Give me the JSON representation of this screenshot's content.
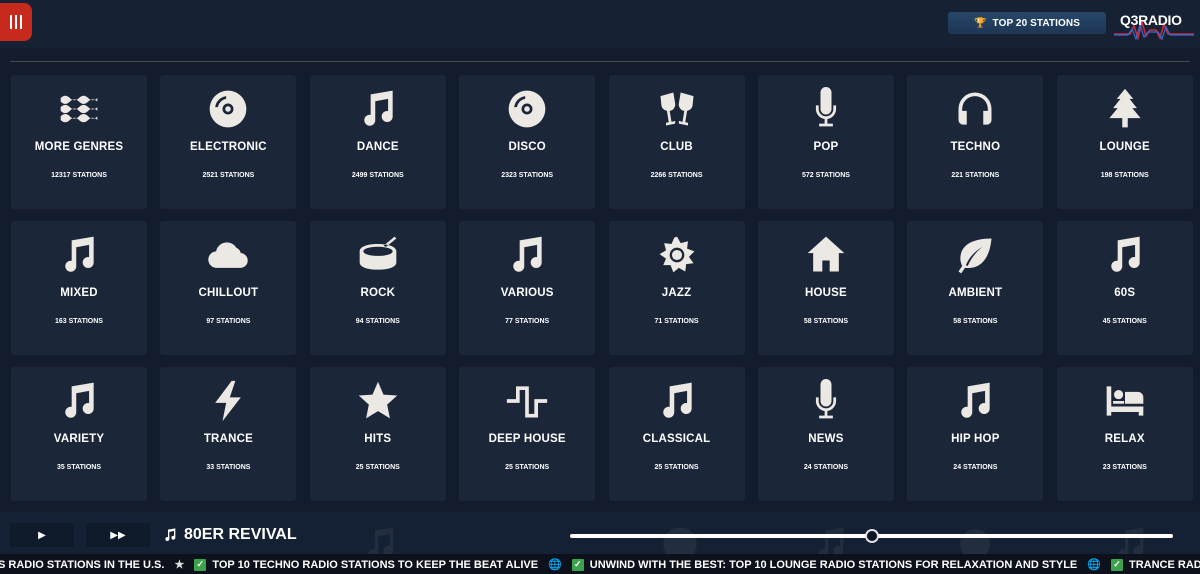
{
  "header": {
    "menu_icon": "hamburger-icon",
    "top20_label": "TOP 20 STATIONS",
    "trophy_icon": "trophy-icon",
    "logo_text": "Q3RADIO",
    "accent": "#c8291d"
  },
  "genres": [
    {
      "name": "MORE GENRES",
      "count": "12317 STATIONS",
      "icon": "waves-icon"
    },
    {
      "name": "ELECTRONIC",
      "count": "2521 STATIONS",
      "icon": "record-icon"
    },
    {
      "name": "DANCE",
      "count": "2499 STATIONS",
      "icon": "music-note-icon"
    },
    {
      "name": "DISCO",
      "count": "2323 STATIONS",
      "icon": "record-icon"
    },
    {
      "name": "CLUB",
      "count": "2266 STATIONS",
      "icon": "glasses-cheers-icon"
    },
    {
      "name": "POP",
      "count": "572 STATIONS",
      "icon": "microphone-icon"
    },
    {
      "name": "TECHNO",
      "count": "221 STATIONS",
      "icon": "headphones-icon"
    },
    {
      "name": "LOUNGE",
      "count": "198 STATIONS",
      "icon": "tree-icon"
    },
    {
      "name": "MIXED",
      "count": "163 STATIONS",
      "icon": "music-note-icon"
    },
    {
      "name": "CHILLOUT",
      "count": "97 STATIONS",
      "icon": "cloud-icon"
    },
    {
      "name": "ROCK",
      "count": "94 STATIONS",
      "icon": "drum-icon"
    },
    {
      "name": "VARIOUS",
      "count": "77 STATIONS",
      "icon": "music-note-icon"
    },
    {
      "name": "JAZZ",
      "count": "71 STATIONS",
      "icon": "sun-icon"
    },
    {
      "name": "HOUSE",
      "count": "58 STATIONS",
      "icon": "house-icon"
    },
    {
      "name": "AMBIENT",
      "count": "58 STATIONS",
      "icon": "leaf-icon"
    },
    {
      "name": "60S",
      "count": "45 STATIONS",
      "icon": "music-note-icon"
    },
    {
      "name": "VARIETY",
      "count": "35 STATIONS",
      "icon": "music-note-icon"
    },
    {
      "name": "TRANCE",
      "count": "33 STATIONS",
      "icon": "bolt-icon"
    },
    {
      "name": "HITS",
      "count": "25 STATIONS",
      "icon": "star-icon"
    },
    {
      "name": "DEEP HOUSE",
      "count": "25 STATIONS",
      "icon": "wave-square-icon"
    },
    {
      "name": "CLASSICAL",
      "count": "25 STATIONS",
      "icon": "music-note-icon"
    },
    {
      "name": "NEWS",
      "count": "24 STATIONS",
      "icon": "microphone-icon"
    },
    {
      "name": "HIP HOP",
      "count": "24 STATIONS",
      "icon": "music-note-icon"
    },
    {
      "name": "RELAX",
      "count": "23 STATIONS",
      "icon": "bed-icon"
    }
  ],
  "player": {
    "play_icon": "play-icon",
    "forward_icon": "fast-forward-icon",
    "now_playing": "80ER REVIVAL",
    "volume_level": 0.5
  },
  "ticker": {
    "items": [
      "S RADIO STATIONS IN THE U.S.",
      "TOP 10 TECHNO RADIO STATIONS TO KEEP THE BEAT ALIVE",
      "UNWIND WITH THE BEST: TOP 10 LOUNGE RADIO STATIONS FOR RELAXATION AND STYLE",
      "TRANCE RADIO ONLINE – TH"
    ]
  }
}
